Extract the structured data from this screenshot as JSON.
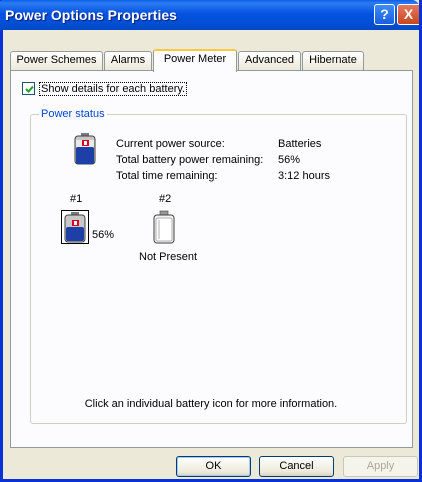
{
  "window": {
    "title": "Power Options Properties",
    "help_glyph": "?",
    "close_glyph": "X"
  },
  "tabs": [
    {
      "label": "Power Schemes"
    },
    {
      "label": "Alarms"
    },
    {
      "label": "Power Meter",
      "active": true
    },
    {
      "label": "Advanced"
    },
    {
      "label": "Hibernate"
    }
  ],
  "details_checkbox": {
    "label": "Show details for each battery.",
    "checked": true
  },
  "power_status": {
    "group_label": "Power status",
    "rows": [
      {
        "label": "Current power source:",
        "value": "Batteries"
      },
      {
        "label": "Total battery power remaining:",
        "value": "56%"
      },
      {
        "label": "Total time remaining:",
        "value": "3:12 hours"
      }
    ]
  },
  "batteries": [
    {
      "number": "#1",
      "status": "56%",
      "charge": 0.56
    },
    {
      "number": "#2",
      "status": "Not Present"
    }
  ],
  "hint_text": "Click an individual battery icon for more information.",
  "buttons": {
    "ok": "OK",
    "cancel": "Cancel",
    "apply": "Apply"
  },
  "colors": {
    "title_bar": "#0553e1",
    "group_label": "#0046d5",
    "battery_blue": "#1f3fa8",
    "battery_red": "#d8001c"
  }
}
